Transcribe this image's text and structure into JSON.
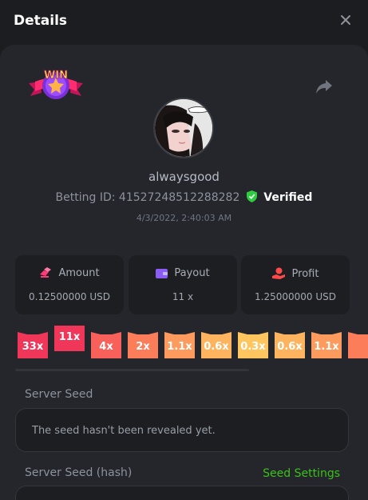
{
  "header": {
    "title": "Details"
  },
  "profile": {
    "username": "alwaysgood",
    "betting_id_label": "Betting ID:",
    "betting_id": "41527248512288282",
    "verified_label": "Verified",
    "timestamp": "4/3/2022, 2:40:03 AM",
    "badge_text": "WIN"
  },
  "stats": [
    {
      "label": "Amount",
      "value": "0.12500000 USD",
      "icon": "coins-icon",
      "color": "#ff3b7a"
    },
    {
      "label": "Payout",
      "value": "11 x",
      "icon": "wallet-icon",
      "color": "#8b5cf6"
    },
    {
      "label": "Profit",
      "value": "1.25000000 USD",
      "icon": "money-hand-icon",
      "color": "#ff4a4a"
    }
  ],
  "multipliers": [
    {
      "label": "33x",
      "color": "#f0375a",
      "selected": false
    },
    {
      "label": "11x",
      "color": "#f0375a",
      "selected": true
    },
    {
      "label": "4x",
      "color": "#f8615a",
      "selected": false
    },
    {
      "label": "2x",
      "color": "#fb7d5a",
      "selected": false
    },
    {
      "label": "1.1x",
      "color": "#fd9a5d",
      "selected": false
    },
    {
      "label": "0.6x",
      "color": "#feb35f",
      "selected": false
    },
    {
      "label": "0.3x",
      "color": "#ffc65f",
      "selected": false
    },
    {
      "label": "0.6x",
      "color": "#feb35f",
      "selected": false
    },
    {
      "label": "1.1x",
      "color": "#fd9a5d",
      "selected": false
    },
    {
      "label": "",
      "color": "#fb7d5a",
      "selected": false
    }
  ],
  "seed": {
    "server_seed_label": "Server Seed",
    "server_seed_value": "The seed hasn't been revealed yet.",
    "server_seed_hash_label": "Server Seed (hash)",
    "seed_settings_label": "Seed Settings"
  },
  "colors": {
    "verified": "#2ecc40",
    "accent_green": "#3bc117"
  }
}
